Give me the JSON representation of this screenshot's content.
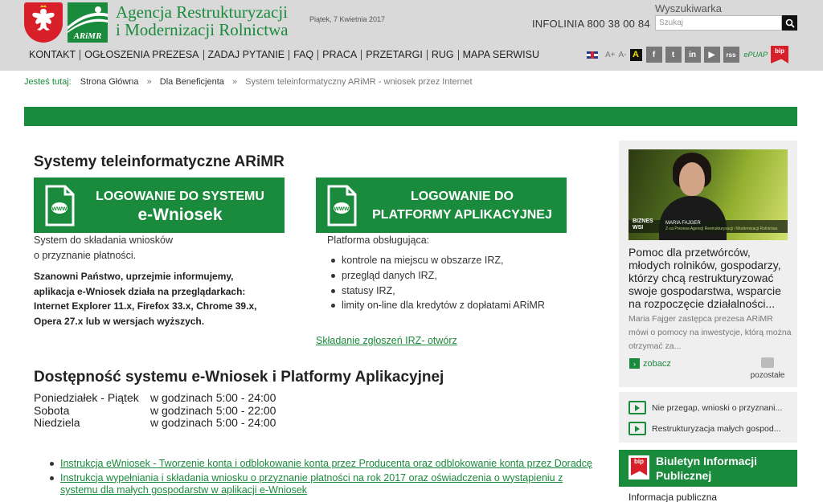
{
  "header": {
    "agency_line1": "Agencja Restrukturyzacji",
    "agency_line2": "i Modernizacji Rolnictwa",
    "logo_text": "ARiMR",
    "date": "Piątek, 7 Kwietnia 2017",
    "hotline": "INFOLINIA 800 38 00 84",
    "search_label": "Wyszukiwarka",
    "search_placeholder": "Szukaj",
    "nav": [
      "KONTAKT",
      "OGŁOSZENIA PREZESA",
      "ZADAJ PYTANIE",
      "FAQ",
      "PRACA",
      "PRZETARGI",
      "RUG",
      "MAPA SERWISU"
    ],
    "font_larger": "A+",
    "font_smaller": "A-",
    "contrast": "A",
    "social": [
      "f",
      "t",
      "in",
      "▶",
      "rss"
    ],
    "epuap": "ePUAP",
    "bip": "bip",
    "icons": [
      "emblem-icon",
      "search-icon",
      "uk-flag-icon",
      "facebook-icon",
      "twitter-icon",
      "linkedin-icon",
      "youtube-icon",
      "rss-icon",
      "epuap-icon",
      "bip-icon"
    ]
  },
  "breadcrumb": {
    "here": "Jesteś tutaj:",
    "items": [
      "Strona Główna",
      "Dla Beneficjenta"
    ],
    "current": "System teleinformatyczny ARiMR - wniosek przez Internet",
    "separator": "»"
  },
  "main": {
    "title": "Systemy teleinformatyczne ARiMR",
    "login_ewniosek": {
      "line1": "LOGOWANIE DO SYSTEMU",
      "line2": "e-Wniosek",
      "doc_label": "www"
    },
    "login_platform": {
      "line1": "LOGOWANIE DO",
      "line2": "PLATFORMY APLIKACYJNEJ",
      "doc_label": "www"
    },
    "ewniosek_desc": [
      "System do składania wniosków",
      "o przyznanie płatności."
    ],
    "notice": "Szanowni Państwo, uprzejmie informujemy, aplikacja e-Wniosek działa na przeglądarkach: Internet Explorer 11.x, Firefox 33.x, Chrome 39.x, Opera 27.x lub w wersjach wyższych.",
    "platform_intro": "Platforma obsługująca:",
    "platform_items": [
      "kontrole na miejscu w obszarze IRZ,",
      "przegląd danych IRZ,",
      "statusy IRZ,",
      "limity on-line dla kredytów z dopłatami ARiMR"
    ],
    "irz_link": "Składanie zgłoszeń IRZ- otwórz",
    "availability_title": "Dostępność systemu e-Wniosek i Platformy Aplikacyjnej",
    "hours": [
      {
        "day": "Poniedziałek - Piątek",
        "time": "w godzinach 5:00 - 24:00"
      },
      {
        "day": "Sobota",
        "time": "w godzinach 5:00 - 22:00"
      },
      {
        "day": "Niedziela",
        "time": "w godzinach 5:00 - 24:00"
      }
    ],
    "links": [
      "Instrukcja eWniosek - Tworzenie konta i odblokowanie konta przez Producenta oraz odblokowanie konta przez Doradcę",
      "Instrukcja wypełniania i składania wniosku o przyznanie płatności na rok 2017 oraz oświadczenia o wystąpieniu z systemu dla małych gospodarstw w aplikacji e-Wniosek"
    ]
  },
  "sidebar": {
    "video": {
      "brand_line1": "BIZNES",
      "brand_line2": "WSI",
      "person": "MARIA FAJGER",
      "person_role": "Z-ca Prezesa Agencji Restrukturyzacji i Modernizacji Rolnictwa"
    },
    "heading": "Pomoc dla przetwórców, młodych rolników, gospodarzy, którzy chcą restrukturyzować swoje gospodarstwa, wsparcie na rozpoczęcie działalności...",
    "text": "Maria Fajger zastępca prezesa ARiMR mówi o pomocy na inwestycje, którą można otrzymać za...",
    "see_more": "zobacz",
    "others": "pozostałe",
    "videos": [
      "Nie przegap, wnioski o przyznani...",
      "Restrukturyzacja małych gospod..."
    ],
    "bip_badge": "bip",
    "bip_title_line1": "Biuletyn Informacji",
    "bip_title_line2": "Publicznej",
    "bip_sub": "Informacja publiczna"
  },
  "colors": {
    "brand_green": "#1a8a3c",
    "header_gray": "#d9d9d9",
    "emblem_red": "#d8202a"
  }
}
